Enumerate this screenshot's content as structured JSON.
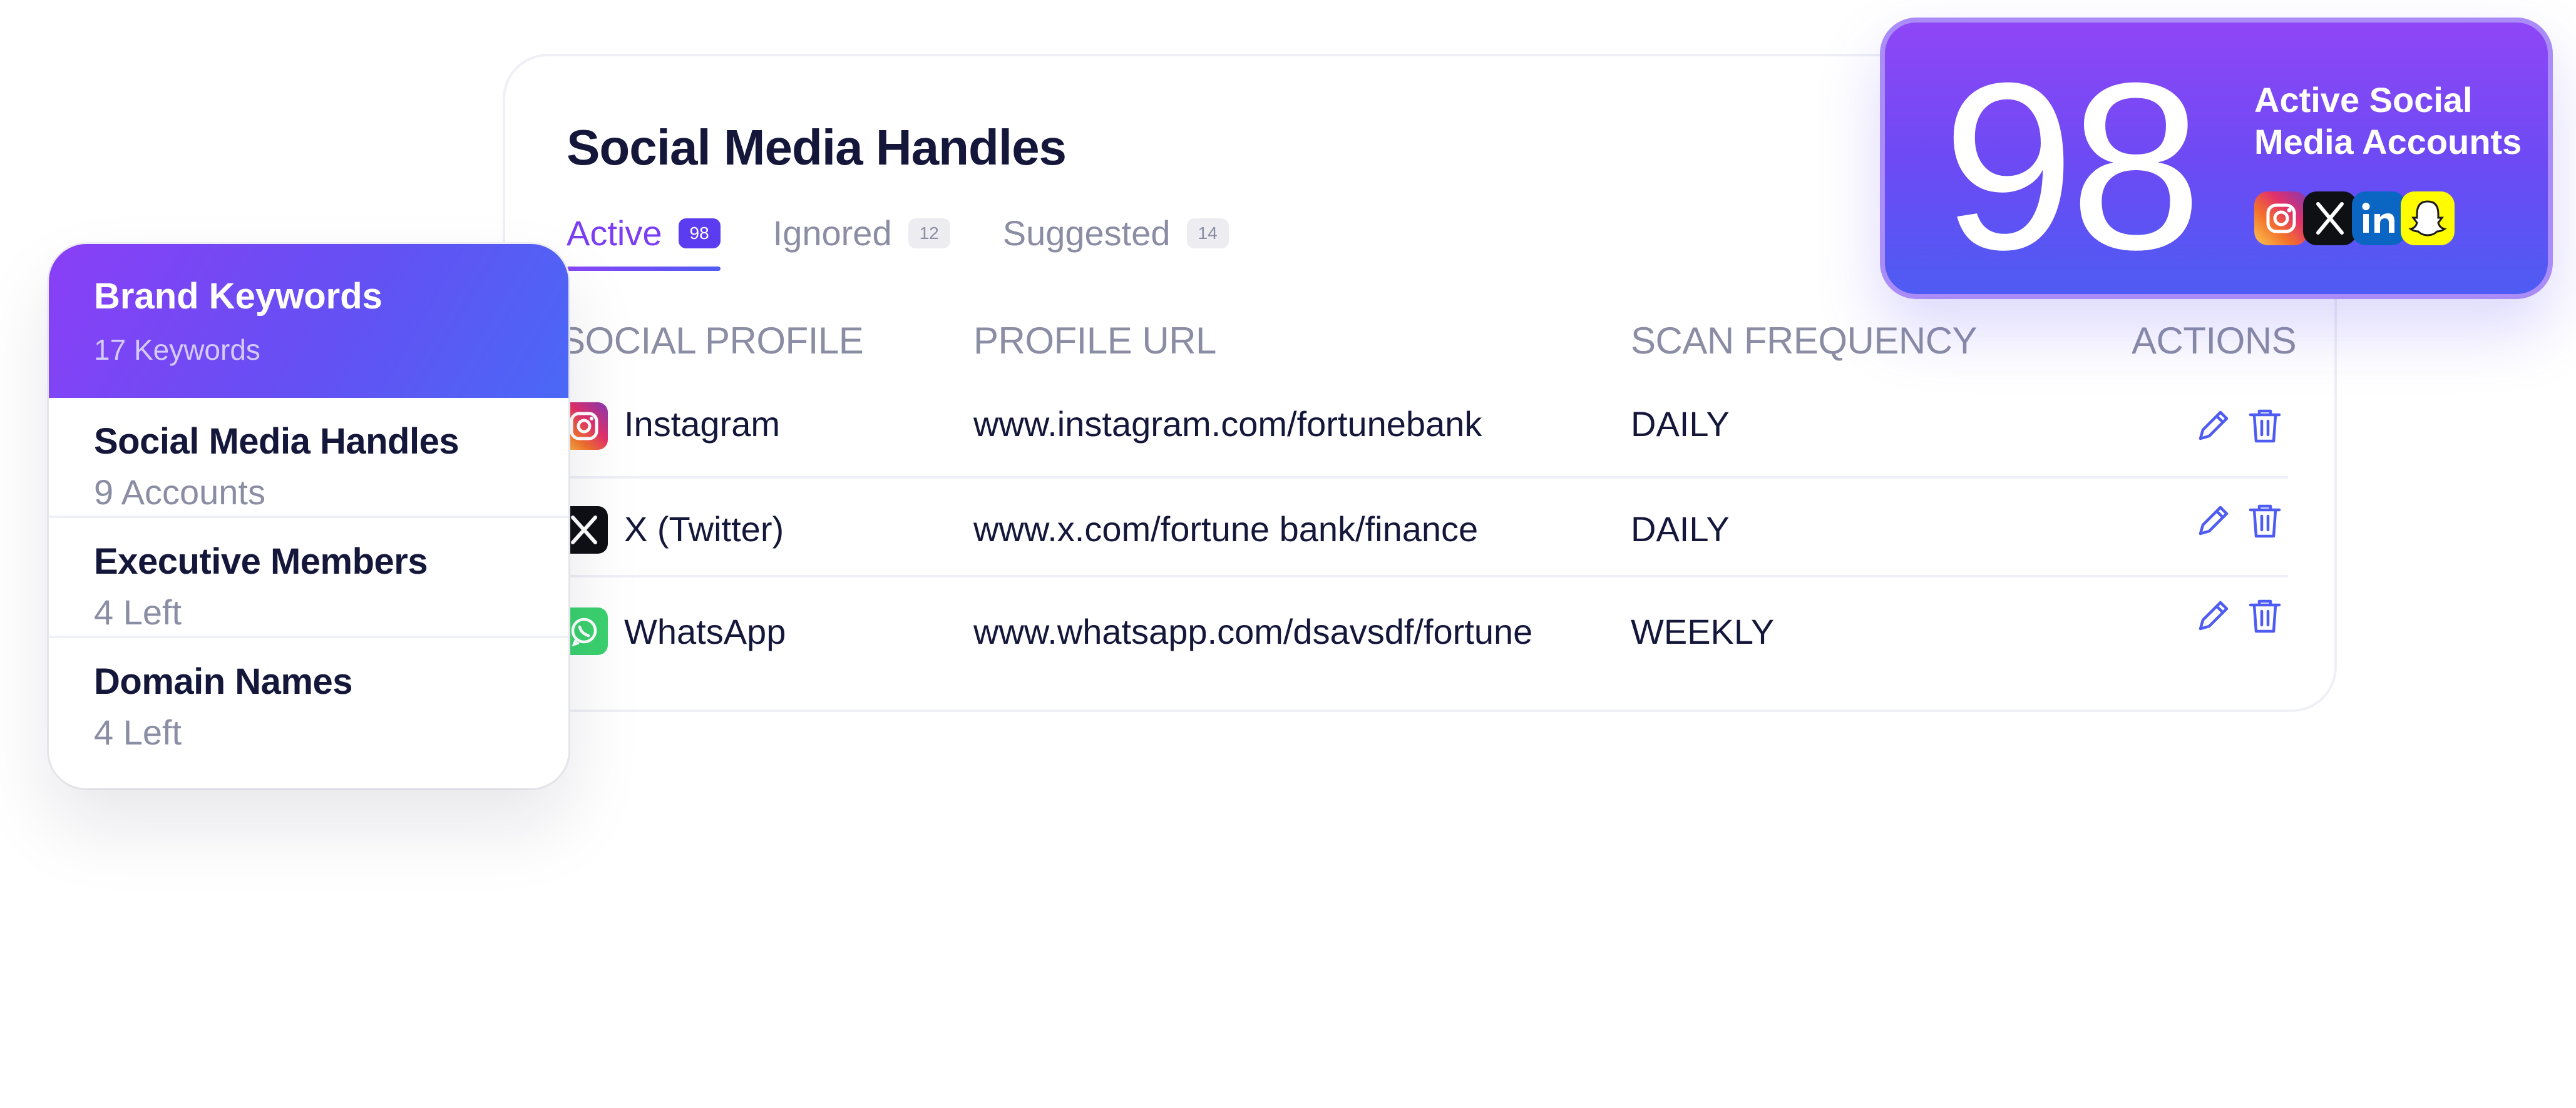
{
  "main": {
    "title": "Social Media Handles",
    "tabs": [
      {
        "label": "Active",
        "count": "98"
      },
      {
        "label": "Ignored",
        "count": "12"
      },
      {
        "label": "Suggested",
        "count": "14"
      }
    ],
    "columns": [
      "SOCIAL PROFILE",
      "PROFILE URL",
      "SCAN FREQUENCY",
      "ACTIONS"
    ],
    "rows": [
      {
        "platform": "Instagram",
        "icon": "instagram-icon",
        "url": "www.instagram.com/fortunebank",
        "frequency": "DAILY"
      },
      {
        "platform": "X (Twitter)",
        "icon": "x-twitter-icon",
        "url": "www.x.com/fortune bank/finance",
        "frequency": "DAILY"
      },
      {
        "platform": "WhatsApp",
        "icon": "whatsapp-icon",
        "url": "www.whatsapp.com/dsavsdf/fortune",
        "frequency": "WEEKLY"
      }
    ]
  },
  "side_panel": {
    "header": {
      "title": "Brand Keywords",
      "subtitle": "17 Keywords"
    },
    "items": [
      {
        "title": "Social Media Handles",
        "subtitle": "9 Accounts"
      },
      {
        "title": "Executive Members",
        "subtitle": "4 Left"
      },
      {
        "title": "Domain Names",
        "subtitle": "4 Left"
      }
    ]
  },
  "stat": {
    "value": "98",
    "label": "Active Social Media Accounts",
    "icons": [
      "instagram-icon",
      "x-icon",
      "linkedin-icon",
      "snapchat-icon"
    ]
  },
  "colors": {
    "accent": "#7a3df3",
    "gradient_start": "#8f46f6",
    "gradient_end": "#4e5cf3",
    "text_dark": "#14173a",
    "text_muted": "#8a8da3",
    "action_icon": "#4f5cf2"
  }
}
